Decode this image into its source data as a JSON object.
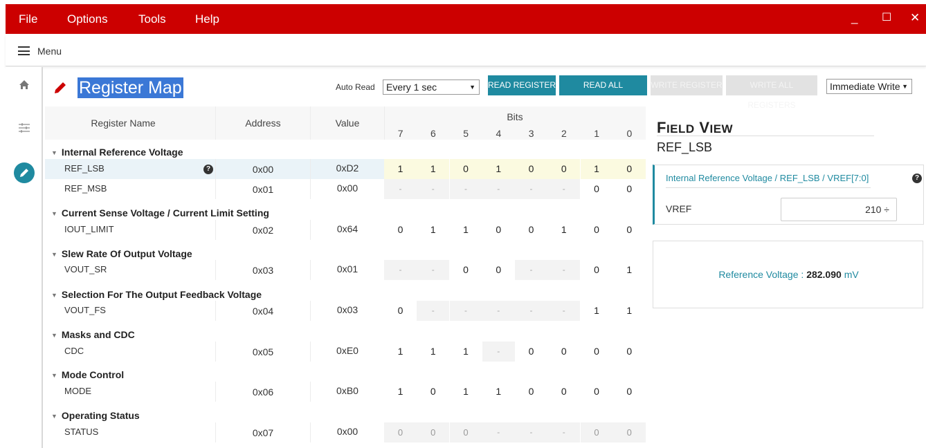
{
  "titlebar": {
    "menus": [
      "File",
      "Options",
      "Tools",
      "Help"
    ],
    "minimize": "_",
    "maximize": "☐",
    "close": "✕"
  },
  "menubar": {
    "label": "Menu"
  },
  "header": {
    "title": "Register Map",
    "auto_read_label": "Auto Read",
    "auto_read_value": "Every 1 sec",
    "buttons": {
      "read_register": "READ REGISTER",
      "read_all": "READ ALL REGISTERS",
      "write_register": "WRITE REGISTER",
      "write_all": "WRITE ALL REGISTERS"
    },
    "write_mode": "Immediate Write"
  },
  "table": {
    "headers": {
      "name": "Register Name",
      "address": "Address",
      "value": "Value",
      "bits": "Bits",
      "bit_cols": [
        "7",
        "6",
        "5",
        "4",
        "3",
        "2",
        "1",
        "0"
      ]
    },
    "groups": [
      {
        "name": "Internal Reference Voltage"
      },
      {
        "name": "Current Sense Voltage / Current Limit Setting"
      },
      {
        "name": "Slew Rate Of Output Voltage"
      },
      {
        "name": "Selection For The Output Feedback Voltage"
      },
      {
        "name": "Masks and CDC"
      },
      {
        "name": "Mode Control"
      },
      {
        "name": "Operating Status"
      }
    ],
    "registers": [
      {
        "name": "REF_LSB",
        "address": "0x00",
        "value": "0xD2",
        "bits": [
          "1",
          "1",
          "0",
          "1",
          "0",
          "0",
          "1",
          "0"
        ]
      },
      {
        "name": "REF_MSB",
        "address": "0x01",
        "value": "0x00",
        "bits": [
          "-",
          "-",
          "-",
          "-",
          "-",
          "-",
          "0",
          "0"
        ]
      },
      {
        "name": "IOUT_LIMIT",
        "address": "0x02",
        "value": "0x64",
        "bits": [
          "0",
          "1",
          "1",
          "0",
          "0",
          "1",
          "0",
          "0"
        ]
      },
      {
        "name": "VOUT_SR",
        "address": "0x03",
        "value": "0x01",
        "bits": [
          "-",
          "-",
          "0",
          "0",
          "-",
          "-",
          "0",
          "1"
        ]
      },
      {
        "name": "VOUT_FS",
        "address": "0x04",
        "value": "0x03",
        "bits": [
          "0",
          "-",
          "-",
          "-",
          "-",
          "-",
          "1",
          "1"
        ]
      },
      {
        "name": "CDC",
        "address": "0x05",
        "value": "0xE0",
        "bits": [
          "1",
          "1",
          "1",
          "-",
          "0",
          "0",
          "0",
          "0"
        ]
      },
      {
        "name": "MODE",
        "address": "0x06",
        "value": "0xB0",
        "bits": [
          "1",
          "0",
          "1",
          "1",
          "0",
          "0",
          "0",
          "0"
        ]
      },
      {
        "name": "STATUS",
        "address": "0x07",
        "value": "0x00",
        "bits": [
          "0",
          "0",
          "0",
          "-",
          "-",
          "-",
          "0",
          "0"
        ]
      }
    ]
  },
  "field_view": {
    "title_big1": "F",
    "title_small1": "IELD",
    "title_big2": "V",
    "title_small2": "IEW",
    "register": "REF_LSB",
    "path": "Internal Reference Voltage / REF_LSB / VREF[7:0]",
    "field_name": "VREF",
    "field_value": "210 ÷",
    "info_label": "Reference Voltage :",
    "info_value": "282.090",
    "info_unit": "mV"
  },
  "colors": {
    "brand": "#cc0000",
    "accent": "#1f8aa0",
    "selected_row": "#eaf3f8",
    "selected_bits": "#fbfae0"
  }
}
